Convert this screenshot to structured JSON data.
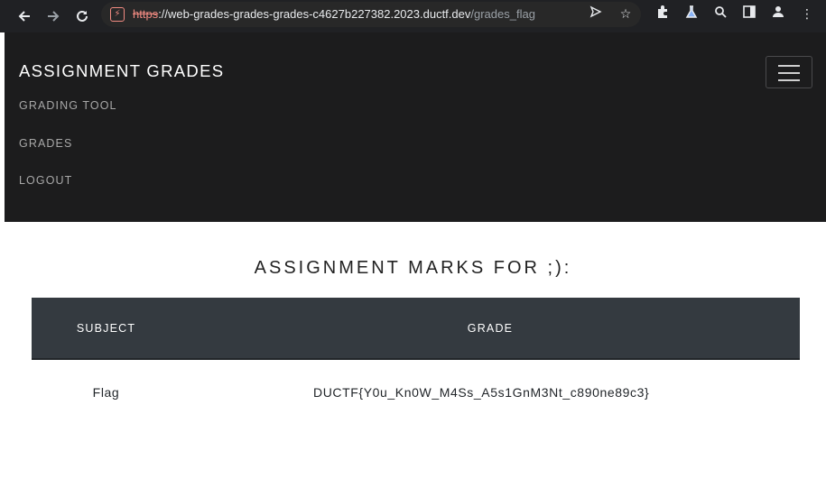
{
  "browser": {
    "url_scheme": "https",
    "url_host": "://web-grades-grades-grades-c4627b227382.2023.ductf.dev",
    "url_path": "/grades_flag",
    "icons": [
      "back-icon",
      "forward-icon",
      "reload-icon",
      "not-secure-icon",
      "send-icon",
      "bookmark-star-icon",
      "extensions-icon",
      "labs-icon",
      "search-icon",
      "side-panel-icon",
      "profile-icon",
      "menu-icon"
    ]
  },
  "navbar": {
    "brand": "ASSIGNMENT GRADES",
    "links": [
      "GRADING TOOL",
      "GRADES",
      "LOGOUT"
    ]
  },
  "main": {
    "title": "ASSIGNMENT MARKS FOR ;):",
    "table": {
      "headers": [
        "SUBJECT",
        "GRADE"
      ],
      "rows": [
        [
          "Flag",
          "DUCTF{Y0u_Kn0W_M4Ss_A5s1GnM3Nt_c890ne89c3}"
        ]
      ]
    }
  },
  "colors": {
    "navbar_bg": "#1c1c1d",
    "table_header_bg": "#343a40",
    "browser_bg": "#202124"
  }
}
